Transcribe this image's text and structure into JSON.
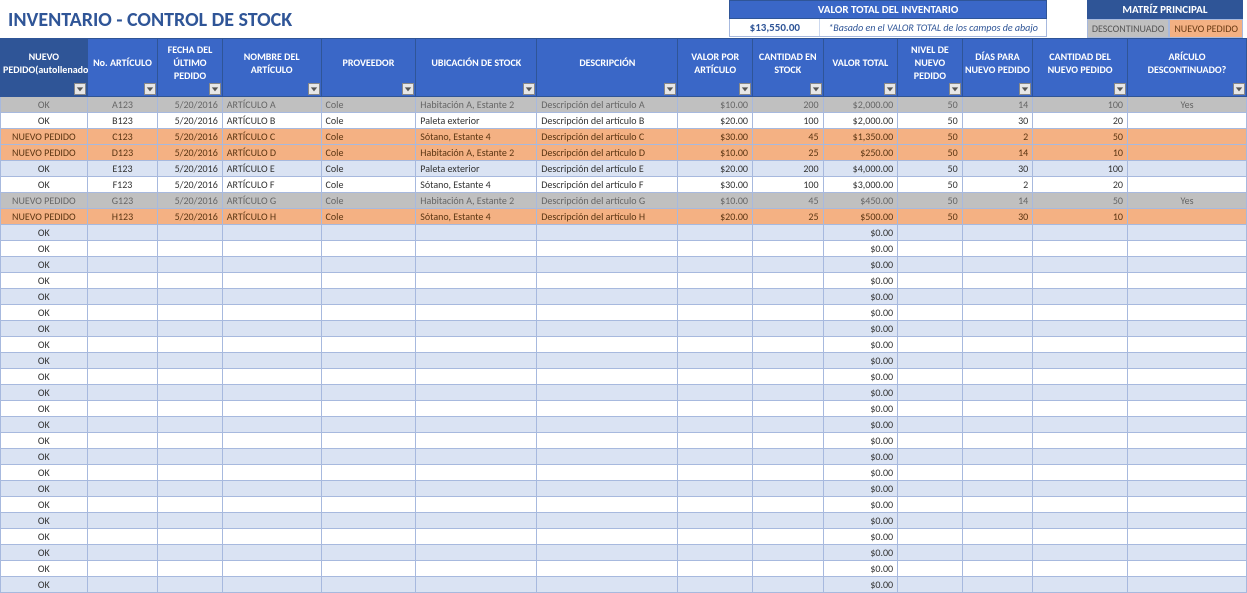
{
  "title": "INVENTARIO - CONTROL DE STOCK",
  "summary": {
    "label": "VALOR TOTAL DEL INVENTARIO",
    "amount": "$13,550.00",
    "note": "*Basado en el VALOR TOTAL de los campos de abajo"
  },
  "legend": {
    "title": "MATRÍZ PRINCIPAL",
    "discontinued": "DESCONTINUADO",
    "reorder": "NUEVO PEDIDO"
  },
  "columns": [
    "NUEVO PEDIDO(autollenado)",
    "No. ARTÍCULO",
    "FECHA DEL ÚLTIMO PEDIDO",
    "NOMBRE DEL ARTÍCULO",
    "PROVEEDOR",
    "UBICACIÓN DE STOCK",
    "DESCRIPCIÓN",
    "VALOR POR ARTÍCULO",
    "CANTIDAD EN STOCK",
    "VALOR TOTAL",
    "NIVEL DE NUEVO PEDIDO",
    "DÍAS PARA NUEVO PEDIDO",
    "CANTIDAD DEL NUEVO PEDIDO",
    "ARÍCULO DESCONTINUADO?"
  ],
  "align": [
    "c-c",
    "c-c",
    "c-r",
    "",
    "",
    "",
    "",
    "c-r",
    "c-r",
    "c-r",
    "c-r",
    "c-r",
    "c-r",
    "c-c"
  ],
  "rows": [
    {
      "state": "disc",
      "cells": [
        "OK",
        "A123",
        "5/20/2016",
        "ARTÍCULO A",
        "Cole",
        "Habitación A, Estante 2",
        "Descripción del artículo A",
        "$10.00",
        "200",
        "$2,000.00",
        "50",
        "14",
        "100",
        "Yes"
      ]
    },
    {
      "state": "",
      "cells": [
        "OK",
        "B123",
        "5/20/2016",
        "ARTÍCULO B",
        "Cole",
        "Paleta exterior",
        "Descripción del artículo B",
        "$20.00",
        "100",
        "$2,000.00",
        "50",
        "30",
        "20",
        ""
      ]
    },
    {
      "state": "reorder",
      "cells": [
        "NUEVO PEDIDO",
        "C123",
        "5/20/2016",
        "ARTÍCULO C",
        "Cole",
        "Sótano, Estante 4",
        "Descripción del artículo C",
        "$30.00",
        "45",
        "$1,350.00",
        "50",
        "2",
        "50",
        ""
      ]
    },
    {
      "state": "reorder",
      "cells": [
        "NUEVO PEDIDO",
        "D123",
        "5/20/2016",
        "ARTÍCULO D",
        "Cole",
        "Habitación A, Estante 2",
        "Descripción del artículo D",
        "$10.00",
        "25",
        "$250.00",
        "50",
        "14",
        "10",
        ""
      ]
    },
    {
      "state": "",
      "cells": [
        "OK",
        "E123",
        "5/20/2016",
        "ARTÍCULO E",
        "Cole",
        "Paleta exterior",
        "Descripción del artículo E",
        "$20.00",
        "200",
        "$4,000.00",
        "50",
        "30",
        "100",
        ""
      ]
    },
    {
      "state": "",
      "cells": [
        "OK",
        "F123",
        "5/20/2016",
        "ARTÍCULO F",
        "Cole",
        "Sótano, Estante 4",
        "Descripción del artículo F",
        "$30.00",
        "100",
        "$3,000.00",
        "50",
        "2",
        "20",
        ""
      ]
    },
    {
      "state": "disc",
      "cells": [
        "NUEVO PEDIDO",
        "G123",
        "5/20/2016",
        "ARTÍCULO G",
        "Cole",
        "Habitación A, Estante 2",
        "Descripción del artículo G",
        "$10.00",
        "45",
        "$450.00",
        "50",
        "14",
        "50",
        "Yes"
      ]
    },
    {
      "state": "reorder",
      "cells": [
        "NUEVO PEDIDO",
        "H123",
        "5/20/2016",
        "ARTÍCULO H",
        "Cole",
        "Sótano, Estante 4",
        "Descripción del artículo H",
        "$20.00",
        "25",
        "$500.00",
        "50",
        "30",
        "10",
        ""
      ]
    },
    {
      "state": "",
      "cells": [
        "OK",
        "",
        "",
        "",
        "",
        "",
        "",
        "",
        "",
        "$0.00",
        "",
        "",
        "",
        ""
      ]
    },
    {
      "state": "",
      "cells": [
        "OK",
        "",
        "",
        "",
        "",
        "",
        "",
        "",
        "",
        "$0.00",
        "",
        "",
        "",
        ""
      ]
    },
    {
      "state": "",
      "cells": [
        "OK",
        "",
        "",
        "",
        "",
        "",
        "",
        "",
        "",
        "$0.00",
        "",
        "",
        "",
        ""
      ]
    },
    {
      "state": "",
      "cells": [
        "OK",
        "",
        "",
        "",
        "",
        "",
        "",
        "",
        "",
        "$0.00",
        "",
        "",
        "",
        ""
      ]
    },
    {
      "state": "",
      "cells": [
        "OK",
        "",
        "",
        "",
        "",
        "",
        "",
        "",
        "",
        "$0.00",
        "",
        "",
        "",
        ""
      ]
    },
    {
      "state": "",
      "cells": [
        "OK",
        "",
        "",
        "",
        "",
        "",
        "",
        "",
        "",
        "$0.00",
        "",
        "",
        "",
        ""
      ]
    },
    {
      "state": "",
      "cells": [
        "OK",
        "",
        "",
        "",
        "",
        "",
        "",
        "",
        "",
        "$0.00",
        "",
        "",
        "",
        ""
      ]
    },
    {
      "state": "",
      "cells": [
        "OK",
        "",
        "",
        "",
        "",
        "",
        "",
        "",
        "",
        "$0.00",
        "",
        "",
        "",
        ""
      ]
    },
    {
      "state": "",
      "cells": [
        "OK",
        "",
        "",
        "",
        "",
        "",
        "",
        "",
        "",
        "$0.00",
        "",
        "",
        "",
        ""
      ]
    },
    {
      "state": "",
      "cells": [
        "OK",
        "",
        "",
        "",
        "",
        "",
        "",
        "",
        "",
        "$0.00",
        "",
        "",
        "",
        ""
      ]
    },
    {
      "state": "",
      "cells": [
        "OK",
        "",
        "",
        "",
        "",
        "",
        "",
        "",
        "",
        "$0.00",
        "",
        "",
        "",
        ""
      ]
    },
    {
      "state": "",
      "cells": [
        "OK",
        "",
        "",
        "",
        "",
        "",
        "",
        "",
        "",
        "$0.00",
        "",
        "",
        "",
        ""
      ]
    },
    {
      "state": "",
      "cells": [
        "OK",
        "",
        "",
        "",
        "",
        "",
        "",
        "",
        "",
        "$0.00",
        "",
        "",
        "",
        ""
      ]
    },
    {
      "state": "",
      "cells": [
        "OK",
        "",
        "",
        "",
        "",
        "",
        "",
        "",
        "",
        "$0.00",
        "",
        "",
        "",
        ""
      ]
    },
    {
      "state": "",
      "cells": [
        "OK",
        "",
        "",
        "",
        "",
        "",
        "",
        "",
        "",
        "$0.00",
        "",
        "",
        "",
        ""
      ]
    },
    {
      "state": "",
      "cells": [
        "OK",
        "",
        "",
        "",
        "",
        "",
        "",
        "",
        "",
        "$0.00",
        "",
        "",
        "",
        ""
      ]
    },
    {
      "state": "",
      "cells": [
        "OK",
        "",
        "",
        "",
        "",
        "",
        "",
        "",
        "",
        "$0.00",
        "",
        "",
        "",
        ""
      ]
    },
    {
      "state": "",
      "cells": [
        "OK",
        "",
        "",
        "",
        "",
        "",
        "",
        "",
        "",
        "$0.00",
        "",
        "",
        "",
        ""
      ]
    },
    {
      "state": "",
      "cells": [
        "OK",
        "",
        "",
        "",
        "",
        "",
        "",
        "",
        "",
        "$0.00",
        "",
        "",
        "",
        ""
      ]
    },
    {
      "state": "",
      "cells": [
        "OK",
        "",
        "",
        "",
        "",
        "",
        "",
        "",
        "",
        "$0.00",
        "",
        "",
        "",
        ""
      ]
    },
    {
      "state": "",
      "cells": [
        "OK",
        "",
        "",
        "",
        "",
        "",
        "",
        "",
        "",
        "$0.00",
        "",
        "",
        "",
        ""
      ]
    },
    {
      "state": "",
      "cells": [
        "OK",
        "",
        "",
        "",
        "",
        "",
        "",
        "",
        "",
        "$0.00",
        "",
        "",
        "",
        ""
      ]
    },
    {
      "state": "",
      "cells": [
        "OK",
        "",
        "",
        "",
        "",
        "",
        "",
        "",
        "",
        "$0.00",
        "",
        "",
        "",
        ""
      ]
    }
  ]
}
